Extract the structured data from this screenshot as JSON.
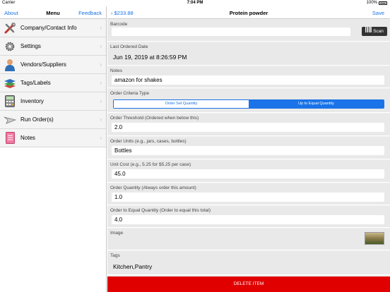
{
  "status_bar": {
    "carrier": "Carrier",
    "time": "7:04 PM",
    "battery": "100%"
  },
  "master": {
    "nav": {
      "left": "About",
      "title": "Menu",
      "right": "Feedback"
    },
    "items": [
      {
        "label": "Company/Contact Info",
        "icon": "tools-icon"
      },
      {
        "label": "Settings",
        "icon": "gear-icon"
      },
      {
        "label": "Vendors/Suppliers",
        "icon": "person-icon"
      },
      {
        "label": "Tags/Labels",
        "icon": "layers-icon"
      },
      {
        "label": "Inventory",
        "icon": "calculator-icon"
      },
      {
        "label": "Run Order(s)",
        "icon": "plane-icon"
      },
      {
        "label": "Notes",
        "icon": "notes-icon"
      }
    ]
  },
  "detail": {
    "nav": {
      "back": "$233.88",
      "title": "Protein powder",
      "save": "Save"
    },
    "barcode": {
      "label": "Barcode",
      "value": "",
      "scan_label": "Scan"
    },
    "last_ordered": {
      "label": "Last Ordered Date",
      "value": "Jun 19, 2019 at 8:26:59 PM"
    },
    "notes": {
      "label": "Notes",
      "value": "amazon for shakes"
    },
    "order_criteria": {
      "label": "Order Criteria Type",
      "options": [
        "Order Set Quantity",
        "Up to Equal Quantity"
      ],
      "selected": "Up to Equal Quantity"
    },
    "threshold": {
      "label": "Order Threshold (Ordered when below this)",
      "value": "2.0"
    },
    "units": {
      "label": "Order Units (e.g., jars, cases, bottles)",
      "value": "Bottles"
    },
    "unit_cost": {
      "label": "Unit Cost (e.g., 5.25 for $5.25 per case)",
      "value": "45.0"
    },
    "order_quantity": {
      "label": "Order Quantity (Always order this amount)",
      "value": "1.0"
    },
    "equal_quantity": {
      "label": "Order to Equal Quantity (Order to equal this total)",
      "value": "4.0"
    },
    "image": {
      "label": "Image"
    },
    "tags": {
      "label": "Tags",
      "value": "Kitchen,Pantry"
    },
    "delete_label": "DELETE ITEM"
  },
  "colors": {
    "accent": "#1a73e8",
    "delete": "#e00000"
  }
}
